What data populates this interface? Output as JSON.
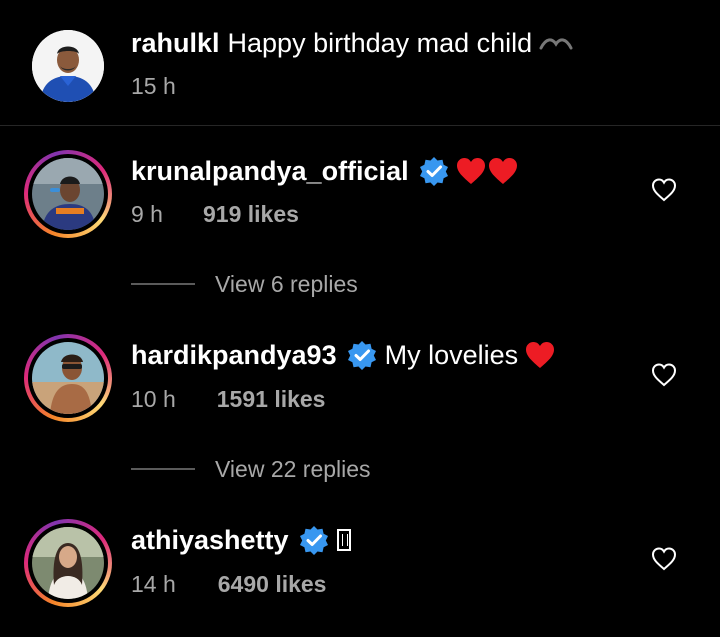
{
  "colors": {
    "background": "#000000",
    "text": "#ffffff",
    "secondary_text": "#a8a8a8",
    "verified_badge": "#3897f0",
    "heart_emoji": "#ed1c24",
    "story_ring": [
      "#f58529",
      "#dd2a7b",
      "#8134af",
      "#feda77"
    ]
  },
  "caption": {
    "username": "rahulkl",
    "text": "Happy birthday mad child",
    "time": "15 h",
    "avatar": "profile-photo"
  },
  "comments": [
    {
      "username": "krunalpandya_official",
      "verified": true,
      "text": "",
      "emoji": [
        "red-heart",
        "red-heart"
      ],
      "time": "9 h",
      "likes": "919 likes",
      "replies_label": "View 6 replies",
      "like_icon": "heart-outline-icon"
    },
    {
      "username": "hardikpandya93",
      "verified": true,
      "text": "My lovelies",
      "emoji": [
        "red-heart"
      ],
      "time": "10 h",
      "likes": "1591 likes",
      "replies_label": "View 22 replies",
      "like_icon": "heart-outline-icon"
    },
    {
      "username": "athiyashetty",
      "verified": true,
      "text": "",
      "emoji": [
        "missing-glyph"
      ],
      "time": "14 h",
      "likes": "6490 likes",
      "like_icon": "heart-outline-icon"
    }
  ]
}
